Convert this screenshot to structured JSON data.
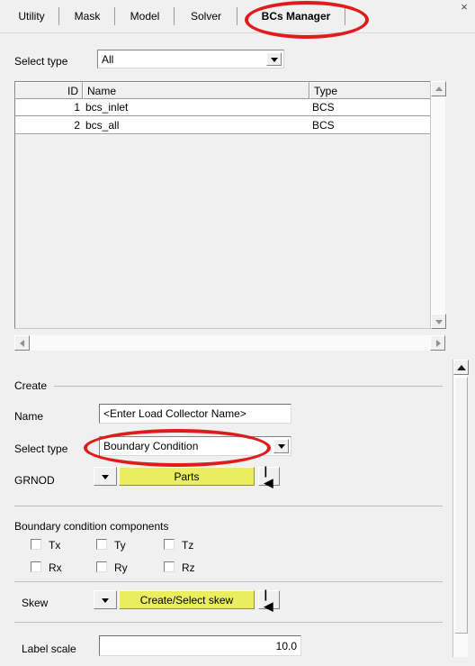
{
  "window": {
    "close_label": "×"
  },
  "tabs": [
    {
      "label": "Utility",
      "active": false
    },
    {
      "label": "Mask",
      "active": false
    },
    {
      "label": "Model",
      "active": false
    },
    {
      "label": "Solver",
      "active": false
    },
    {
      "label": "BCs Manager",
      "active": true
    }
  ],
  "filter": {
    "label": "Select type",
    "value": "All"
  },
  "table": {
    "columns": [
      "ID",
      "Name",
      "Type"
    ],
    "rows": [
      {
        "id": "1",
        "name": "bcs_inlet",
        "type": "BCS"
      },
      {
        "id": "2",
        "name": "bcs_all",
        "type": "BCS"
      }
    ]
  },
  "create": {
    "group_title": "Create",
    "name_label": "Name",
    "name_value": "<Enter Load Collector Name>",
    "select_type_label": "Select type",
    "select_type_value": "Boundary Condition",
    "entity_label": "GRNOD",
    "entity_button": "Parts",
    "rewind_icon": "|◀"
  },
  "components": {
    "title": "Boundary condition components",
    "items": [
      {
        "label": "Tx",
        "checked": false
      },
      {
        "label": "Ty",
        "checked": false
      },
      {
        "label": "Tz",
        "checked": false
      },
      {
        "label": "Rx",
        "checked": false
      },
      {
        "label": "Ry",
        "checked": false
      },
      {
        "label": "Rz",
        "checked": false
      }
    ]
  },
  "skew": {
    "label": "Skew",
    "button": "Create/Select skew",
    "rewind_icon": "|◀"
  },
  "label_scale": {
    "label": "Label scale",
    "value": "10.0"
  },
  "colors": {
    "background": "#f0f0f0",
    "accent_yellow": "#e9ed5f",
    "annotation_red": "#e01b1b",
    "field_white": "#ffffff"
  }
}
